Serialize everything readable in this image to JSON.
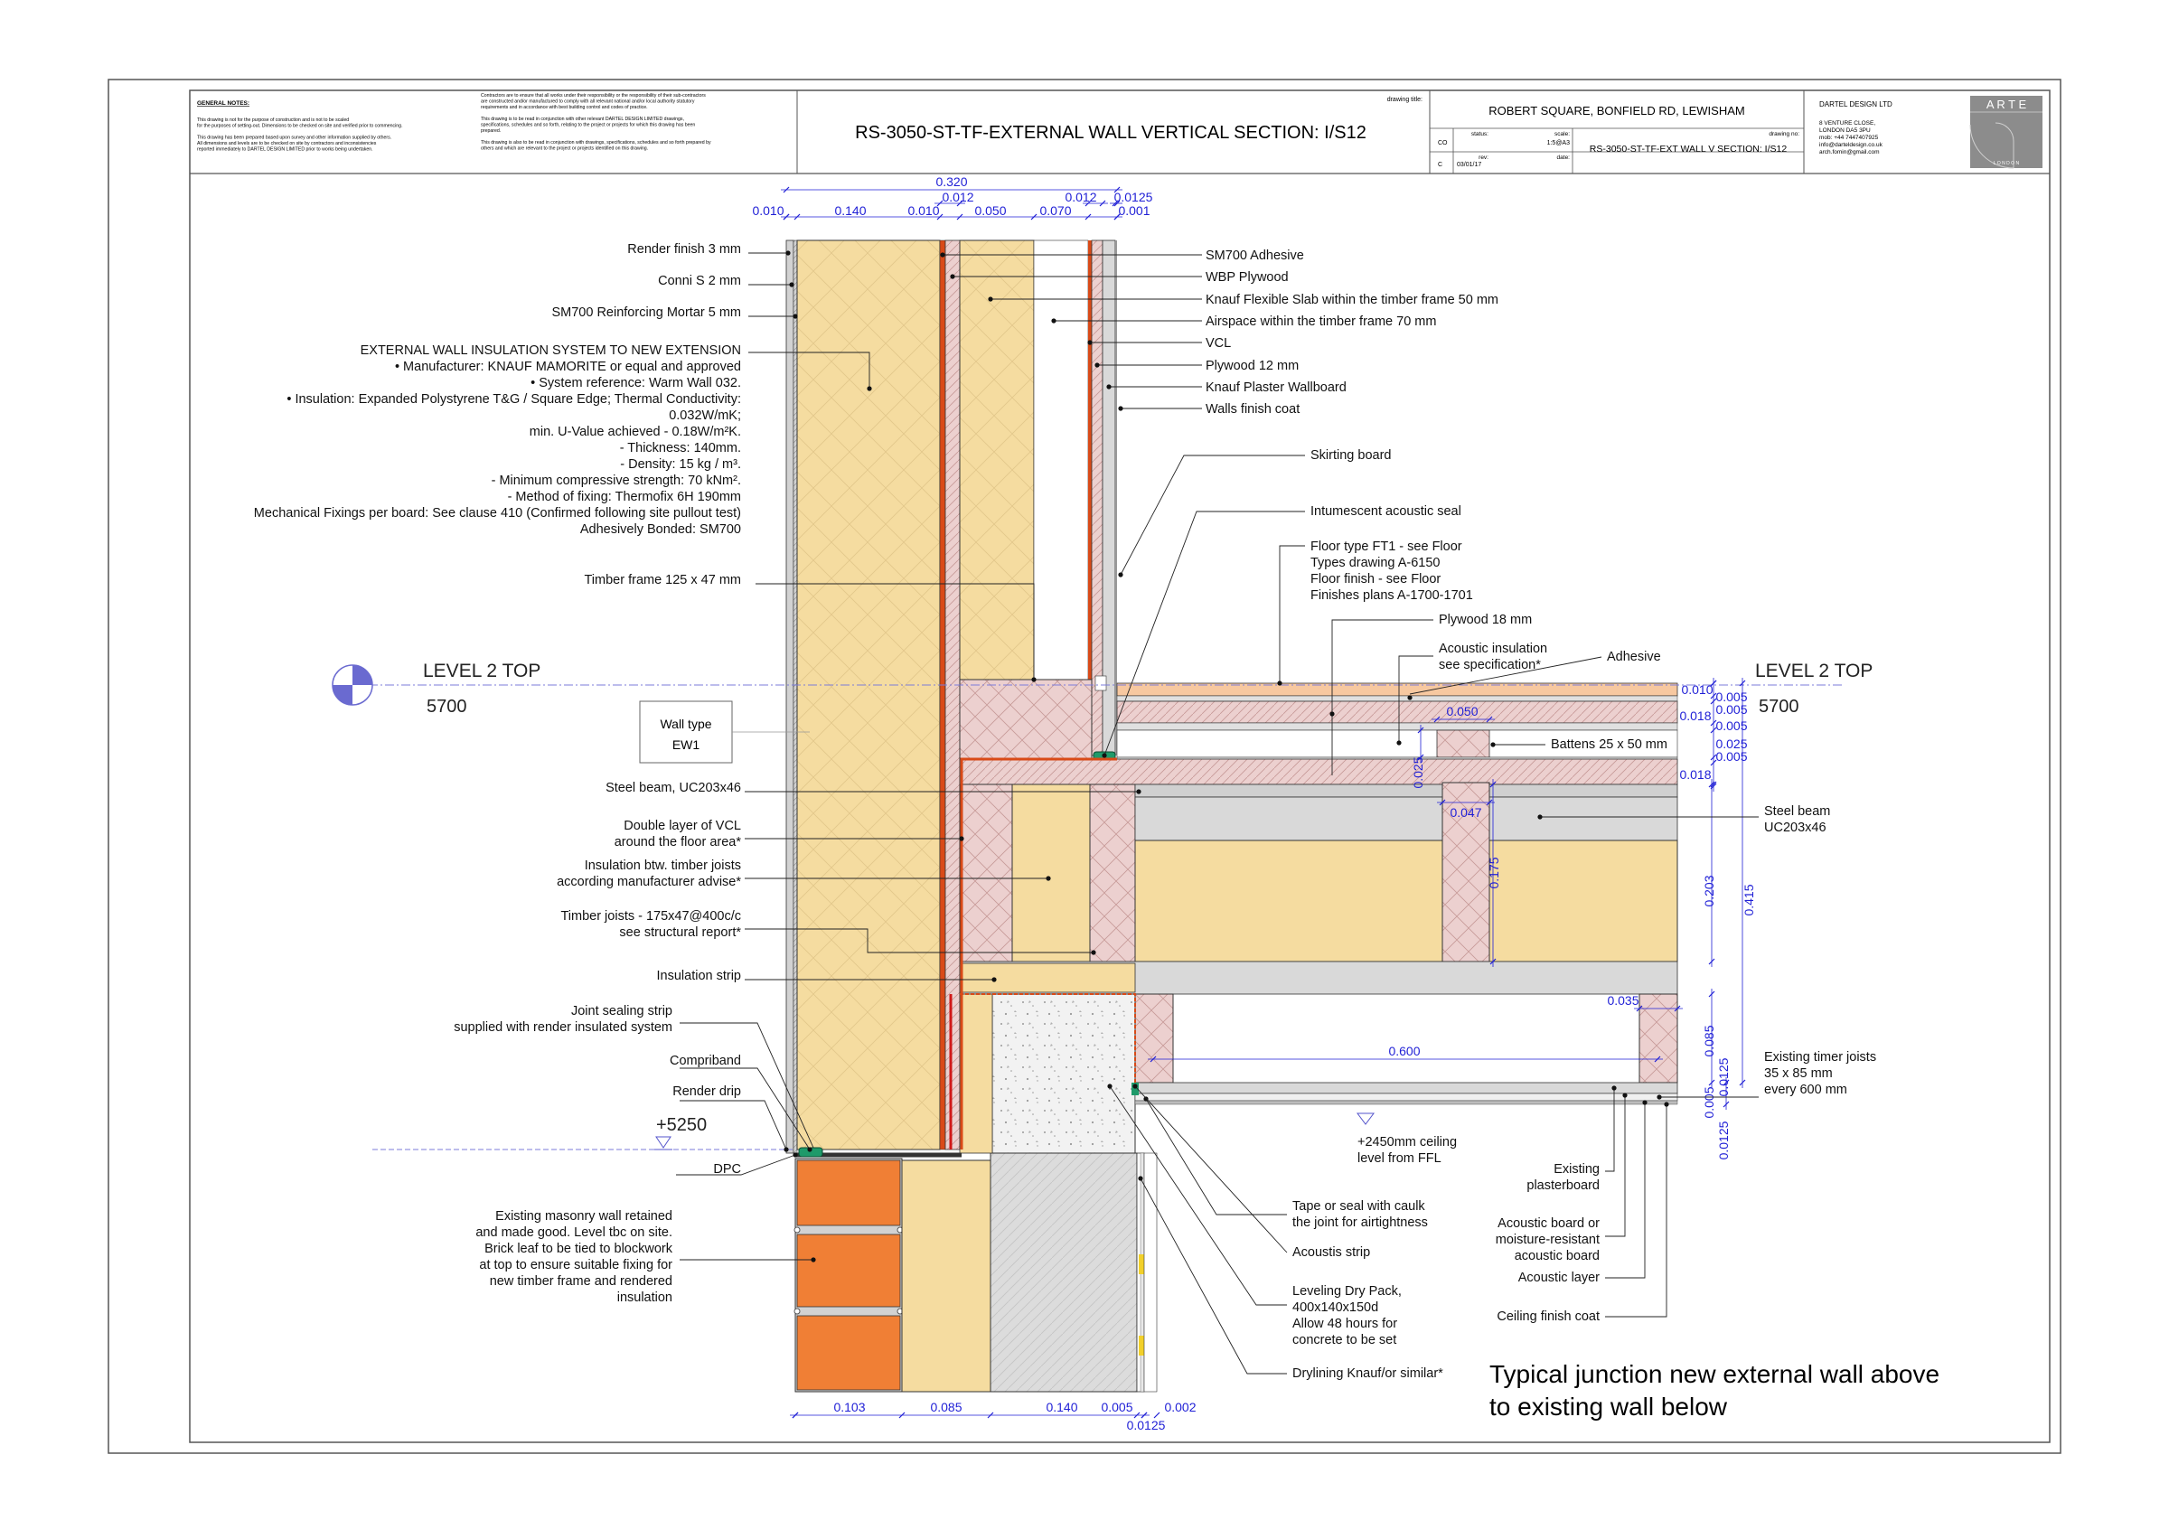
{
  "title_block": {
    "general_notes_heading": "GENERAL NOTES:",
    "notes_left": [
      "This drawing is not for the purpose of construction and is not to be scaled",
      "for the purposes of setting-out. Dimensions to be checked on site and verified prior to commencing.",
      "",
      "This drawing has been prepared based upon survey and other information supplied by others.",
      "All dimensions and levels are to be checked on site by contractors and inconsistencies",
      "reported immediately to DARTEL DESIGN LIMITED prior to works being undertaken."
    ],
    "notes_right": [
      "Contractors are to ensure that all works under their responsibility or the responsibility of their sub-contractors",
      "are constructed and/or manufactured to comply with all relevant national and/or local authority statutory",
      "requirements and in accordance with best building control and codes of practice.",
      "",
      "This drawing is to be read in conjunction with other relevant DARTEL DESIGN LIMITED drawings,",
      "specifications, schedules and so forth, relating to the project or projects for which this drawing has been",
      "prepared.",
      "",
      "This drawing is also to be read in conjunction with drawings, specifications, schedules and so forth prepared by",
      "others and which are relevant to the project or projects identified on this drawing."
    ],
    "drawing_title_label": "drawing title:",
    "drawing_title": "RS-3050-ST-TF-EXTERNAL WALL VERTICAL SECTION: I/S12",
    "project": "ROBERT SQUARE, BONFIELD RD, LEWISHAM",
    "status_label": "status:",
    "status": "CO",
    "scale_label": "scale:",
    "scale": "1:5@A3",
    "drawing_no_label": "drawing no:",
    "drawing_no": "RS-3050-ST-TF-EXT WALL V SECTION: I/S12",
    "rev_label": "rev:",
    "rev": "C",
    "date_label": "date:",
    "date": "03/01/17",
    "company": "DARTEL DESIGN LTD",
    "address": [
      "8 VENTURE CLOSE,",
      "LONDON DA5 3PU",
      "mob: +44 7447407925",
      "info@darteldesign.co.uk",
      "arch.fomin@gmail.com"
    ],
    "logo_text": "A R T E",
    "logo_sub": "L O N D O N"
  },
  "top_dimensions": {
    "overall": "0.320",
    "row1": [
      "0.012",
      "0.012",
      "0.0125"
    ],
    "row2": [
      "0.010",
      "0.140",
      "0.010",
      "0.050",
      "0.070",
      "0.001"
    ]
  },
  "bottom_dimensions": [
    "0.103",
    "0.085",
    "0.140",
    "0.005",
    "0.002",
    "0.0125"
  ],
  "left_labels": {
    "render_finish": "Render finish 3 mm",
    "conni": "Conni S 2 mm",
    "mortar": "SM700 Reinforcing Mortar 5 mm",
    "insulation_spec": [
      "EXTERNAL WALL INSULATION SYSTEM TO NEW EXTENSION",
      "• Manufacturer: KNAUF MAMORITE or equal and approved",
      "• System reference: Warm Wall 032.",
      "• Insulation: Expanded Polystyrene T&G / Square Edge; Thermal Conductivity:",
      "0.032W/mK;",
      "min. U-Value achieved - 0.18W/m²K.",
      "- Thickness: 140mm.",
      "- Density: 15 kg / m³.",
      "- Minimum compressive strength: 70 kNm².",
      "- Method of fixing: Thermofix 6H 190mm",
      "Mechanical Fixings per board: See clause 410 (Confirmed following site pullout test)",
      "Adhesively Bonded: SM700"
    ],
    "timber_frame": "Timber frame 125 x 47 mm",
    "steel_beam": "Steel beam, UC203x46",
    "double_vcl": [
      "Double layer of VCL",
      "around the floor area*"
    ],
    "insulation_joists": [
      "Insulation btw. timber joists",
      "according manufacturer advise*"
    ],
    "timber_joists": [
      "Timber joists - 175x47@400c/c",
      "see structural report*"
    ],
    "insulation_strip": "Insulation strip",
    "joint_sealing": [
      "Joint sealing strip",
      "supplied with render insulated system"
    ],
    "compriband": "Compriband",
    "render_drip": "Render drip",
    "dpc": "DPC",
    "masonry": [
      "Existing masonry wall retained",
      "and made good. Level  tbc on site.",
      "Brick leaf to be tied to blockwork",
      "at top to ensure suitable fixing for",
      "new timber frame and rendered",
      "insulation"
    ]
  },
  "right_labels": {
    "sm700": "SM700 Adhesive",
    "wbp": "WBP Plywood",
    "knauf_slab": "Knauf Flexible Slab within the timber frame 50 mm",
    "airspace": "Airspace within the timber frame 70 mm",
    "vcl": "VCL",
    "plywood12": "Plywood 12 mm",
    "plasterboard": "Knauf Plaster Wallboard",
    "walls_finish": "Walls finish coat",
    "skirting": "Skirting board",
    "acoustic_seal": "Intumescent acoustic seal",
    "floor_type": [
      "Floor type FT1 - see Floor",
      "Types drawing A-6150",
      "Floor finish - see Floor",
      "Finishes plans A-1700-1701"
    ],
    "plywood18": "Plywood 18 mm",
    "acoustic_insulation": [
      "Acoustic insulation",
      "see specification*"
    ],
    "adhesive": "Adhesive",
    "battens": "Battens 25 x 50 mm",
    "steel_beam_r": [
      "Steel beam",
      "UC203x46"
    ],
    "existing_joists": [
      "Existing timer joists",
      "35 x 85 mm",
      "every 600 mm"
    ],
    "ceiling_level": [
      "+2450mm ceiling",
      "level  from FFL"
    ],
    "existing_plasterboard": [
      "Existing",
      "plasterboard"
    ],
    "acoustic_board": [
      "Acoustic board or",
      "moisture-resistant",
      "acoustic board"
    ],
    "acoustic_layer": "Acoustic layer",
    "ceiling_finish": "Ceiling finish coat",
    "tape_seal": [
      "Tape  or seal with caulk",
      "the joint for airtightness"
    ],
    "acoustis_strip": "Acoustis strip",
    "dry_pack": [
      "Leveling Dry Pack,",
      "400x140x150d",
      "Allow 48 hours for",
      "concrete to be set"
    ],
    "drylining": "Drylining Knauf/or similar*"
  },
  "levels": {
    "left_name": "LEVEL 2 TOP",
    "left_value": "5700",
    "right_name": "LEVEL 2 TOP",
    "right_value": "5700",
    "lower_value": "+5250"
  },
  "wall_type": [
    "Wall type",
    "EW1"
  ],
  "floor_dimensions": {
    "stack": [
      "0.010",
      "0.005",
      "0.018",
      "0.005",
      "0.005",
      "0.025",
      "0.005",
      "0.018"
    ],
    "batten_w": "0.050",
    "batten_h": "0.025",
    "joist_w": "0.047",
    "joist_h": "0.175",
    "total_203": "0.203",
    "total_415": "0.415",
    "exist_joist_w": "0.035",
    "span": "0.600",
    "exist_085": "0.085",
    "exist_0125a": "0.0125",
    "exist_005": "0.005",
    "exist_0125b": "0.0125"
  },
  "caption": [
    "Typical junction new external wall above",
    "to existing wall below"
  ],
  "colors": {
    "insulation": "#f5dca0",
    "timber": "#ecd0cf",
    "brick": "#f07f35",
    "steel": "#d9d9d9",
    "concrete": "#f0f0f0",
    "block": "#dcdcdc",
    "dimension": "#1f1fd6",
    "vcl": "#d94a18"
  }
}
